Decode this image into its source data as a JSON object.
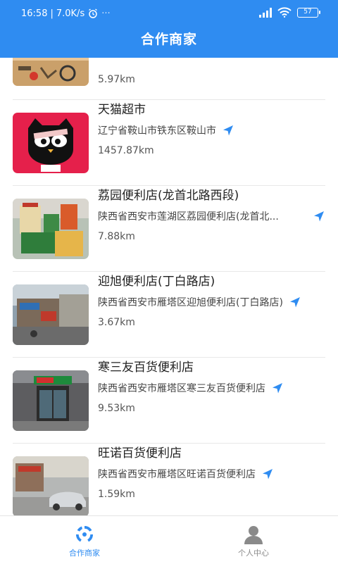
{
  "status_bar": {
    "time": "16:58",
    "network_speed": "7.0K/s",
    "battery": "57"
  },
  "header": {
    "title": "合作商家"
  },
  "stores": [
    {
      "name": "",
      "address": "",
      "distance": "5.97km"
    },
    {
      "name": "天猫超市",
      "address": "辽宁省鞍山市铁东区鞍山市",
      "distance": "1457.87km"
    },
    {
      "name": "荔园便利店(龙首北路西段)",
      "address": "陕西省西安市莲湖区荔园便利店(龙首北...",
      "distance": "7.88km"
    },
    {
      "name": "迎旭便利店(丁白路店)",
      "address": "陕西省西安市雁塔区迎旭便利店(丁白路店)",
      "distance": "3.67km"
    },
    {
      "name": "寒三友百货便利店",
      "address": "陕西省西安市雁塔区寒三友百货便利店",
      "distance": "9.53km"
    },
    {
      "name": "旺诺百货便利店",
      "address": "陕西省西安市雁塔区旺诺百货便利店",
      "distance": "1.59km"
    }
  ],
  "tabbar": {
    "tabs": [
      {
        "label": "合作商家",
        "icon": "recycle-icon",
        "active": true
      },
      {
        "label": "个人中心",
        "icon": "user-icon",
        "active": false
      }
    ]
  },
  "colors": {
    "primary": "#2f8cf1",
    "inactive": "#8a8a8a"
  }
}
